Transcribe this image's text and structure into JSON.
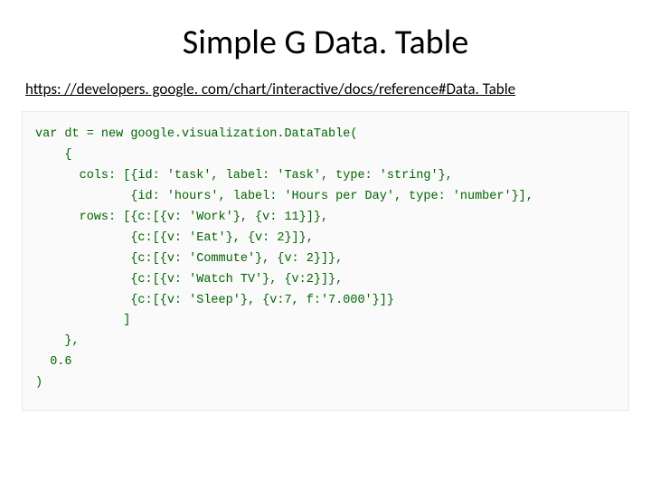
{
  "title": "Simple G Data. Table",
  "link_text": "https: //developers. google. com/chart/interactive/docs/reference#Data. Table",
  "code": "var dt = new google.visualization.DataTable(\n    {\n      cols: [{id: 'task', label: 'Task', type: 'string'},\n             {id: 'hours', label: 'Hours per Day', type: 'number'}],\n      rows: [{c:[{v: 'Work'}, {v: 11}]},\n             {c:[{v: 'Eat'}, {v: 2}]},\n             {c:[{v: 'Commute'}, {v: 2}]},\n             {c:[{v: 'Watch TV'}, {v:2}]},\n             {c:[{v: 'Sleep'}, {v:7, f:'7.000'}]}\n            ]\n    },\n  0.6\n)"
}
